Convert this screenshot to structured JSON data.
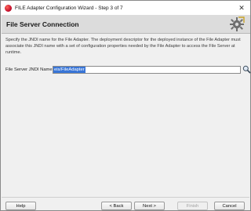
{
  "window": {
    "title": "FILE Adapter Configuration Wizard - Step 3 of 7",
    "controls": {
      "close": "✕"
    }
  },
  "header": {
    "title": "File Server Connection"
  },
  "main": {
    "description": "Specify the JNDI name for the File Adapter. The deployment descriptor for the deployed instance of the File Adapter must associate this JNDI name with a set of configuration properties needed by the File Adapter to access the File Server at runtime.",
    "jndi_field": {
      "label": "File Server JNDI Name",
      "value": "eis/FileAdapter"
    }
  },
  "footer": {
    "help": "Help",
    "back": "< Back",
    "next": "Next >",
    "finish": "Finish",
    "cancel": "Cancel"
  },
  "colors": {
    "selection": "#3875d7",
    "header_band": "#dcdcdc",
    "dialog_bg": "#f0f0f0"
  }
}
